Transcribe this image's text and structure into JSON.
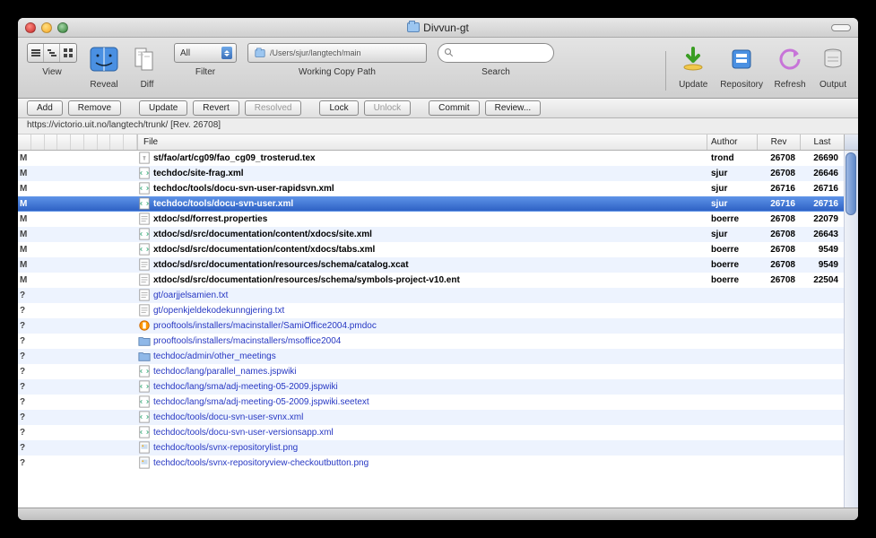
{
  "window": {
    "title": "Divvun-gt"
  },
  "toolbar": {
    "view": "View",
    "reveal": "Reveal",
    "diff": "Diff",
    "filter": "Filter",
    "filter_value": "All",
    "path_label": "Working Copy Path",
    "path_value": "/Users/sjur/langtech/main",
    "search": "Search",
    "update": "Update",
    "repository": "Repository",
    "refresh": "Refresh",
    "output": "Output"
  },
  "actions": {
    "add": "Add",
    "remove": "Remove",
    "update": "Update",
    "revert": "Revert",
    "resolved": "Resolved",
    "lock": "Lock",
    "unlock": "Unlock",
    "commit": "Commit",
    "review": "Review..."
  },
  "path_info": "https://victorio.uit.no/langtech/trunk/  [Rev. 26708]",
  "headers": {
    "file": "File",
    "author": "Author",
    "rev": "Rev",
    "last": "Last"
  },
  "rows": [
    {
      "status": "M",
      "icon": "tex",
      "file": "st/fao/art/cg09/fao_cg09_trosterud.tex",
      "author": "trond",
      "rev": "26708",
      "last": "26690",
      "sel": false,
      "unv": false
    },
    {
      "status": "M",
      "icon": "xml",
      "file": "techdoc/site-frag.xml",
      "author": "sjur",
      "rev": "26708",
      "last": "26646",
      "sel": false,
      "unv": false
    },
    {
      "status": "M",
      "icon": "xml",
      "file": "techdoc/tools/docu-svn-user-rapidsvn.xml",
      "author": "sjur",
      "rev": "26716",
      "last": "26716",
      "sel": false,
      "unv": false
    },
    {
      "status": "M",
      "icon": "xml",
      "file": "techdoc/tools/docu-svn-user.xml",
      "author": "sjur",
      "rev": "26716",
      "last": "26716",
      "sel": true,
      "unv": false
    },
    {
      "status": "M",
      "icon": "txt",
      "file": "xtdoc/sd/forrest.properties",
      "author": "boerre",
      "rev": "26708",
      "last": "22079",
      "sel": false,
      "unv": false
    },
    {
      "status": "M",
      "icon": "xml",
      "file": "xtdoc/sd/src/documentation/content/xdocs/site.xml",
      "author": "sjur",
      "rev": "26708",
      "last": "26643",
      "sel": false,
      "unv": false
    },
    {
      "status": "M",
      "icon": "xml",
      "file": "xtdoc/sd/src/documentation/content/xdocs/tabs.xml",
      "author": "boerre",
      "rev": "26708",
      "last": "9549",
      "sel": false,
      "unv": false
    },
    {
      "status": "M",
      "icon": "txt",
      "file": "xtdoc/sd/src/documentation/resources/schema/catalog.xcat",
      "author": "boerre",
      "rev": "26708",
      "last": "9549",
      "sel": false,
      "unv": false
    },
    {
      "status": "M",
      "icon": "txt",
      "file": "xtdoc/sd/src/documentation/resources/schema/symbols-project-v10.ent",
      "author": "boerre",
      "rev": "26708",
      "last": "22504",
      "sel": false,
      "unv": false
    },
    {
      "status": "?",
      "icon": "txt",
      "file": "gt/oarjjelsamien.txt",
      "author": "",
      "rev": "",
      "last": "",
      "sel": false,
      "unv": true
    },
    {
      "status": "?",
      "icon": "txt",
      "file": "gt/openkjeldekodekunngjering.txt",
      "author": "",
      "rev": "",
      "last": "",
      "sel": false,
      "unv": true
    },
    {
      "status": "?",
      "icon": "pkg",
      "file": "prooftools/installers/macinstaller/SamiOffice2004.pmdoc",
      "author": "",
      "rev": "",
      "last": "",
      "sel": false,
      "unv": true
    },
    {
      "status": "?",
      "icon": "folder",
      "file": "prooftools/installers/macinstallers/msoffice2004",
      "author": "",
      "rev": "",
      "last": "",
      "sel": false,
      "unv": true
    },
    {
      "status": "?",
      "icon": "folder",
      "file": "techdoc/admin/other_meetings",
      "author": "",
      "rev": "",
      "last": "",
      "sel": false,
      "unv": true
    },
    {
      "status": "?",
      "icon": "xml",
      "file": "techdoc/lang/parallel_names.jspwiki",
      "author": "",
      "rev": "",
      "last": "",
      "sel": false,
      "unv": true
    },
    {
      "status": "?",
      "icon": "xml",
      "file": "techdoc/lang/sma/adj-meeting-05-2009.jspwiki",
      "author": "",
      "rev": "",
      "last": "",
      "sel": false,
      "unv": true
    },
    {
      "status": "?",
      "icon": "xml",
      "file": "techdoc/lang/sma/adj-meeting-05-2009.jspwiki.seetext",
      "author": "",
      "rev": "",
      "last": "",
      "sel": false,
      "unv": true
    },
    {
      "status": "?",
      "icon": "xml",
      "file": "techdoc/tools/docu-svn-user-svnx.xml",
      "author": "",
      "rev": "",
      "last": "",
      "sel": false,
      "unv": true
    },
    {
      "status": "?",
      "icon": "xml",
      "file": "techdoc/tools/docu-svn-user-versionsapp.xml",
      "author": "",
      "rev": "",
      "last": "",
      "sel": false,
      "unv": true
    },
    {
      "status": "?",
      "icon": "png",
      "file": "techdoc/tools/svnx-repositorylist.png",
      "author": "",
      "rev": "",
      "last": "",
      "sel": false,
      "unv": true
    },
    {
      "status": "?",
      "icon": "png",
      "file": "techdoc/tools/svnx-repositoryview-checkoutbutton.png",
      "author": "",
      "rev": "",
      "last": "",
      "sel": false,
      "unv": true
    }
  ]
}
